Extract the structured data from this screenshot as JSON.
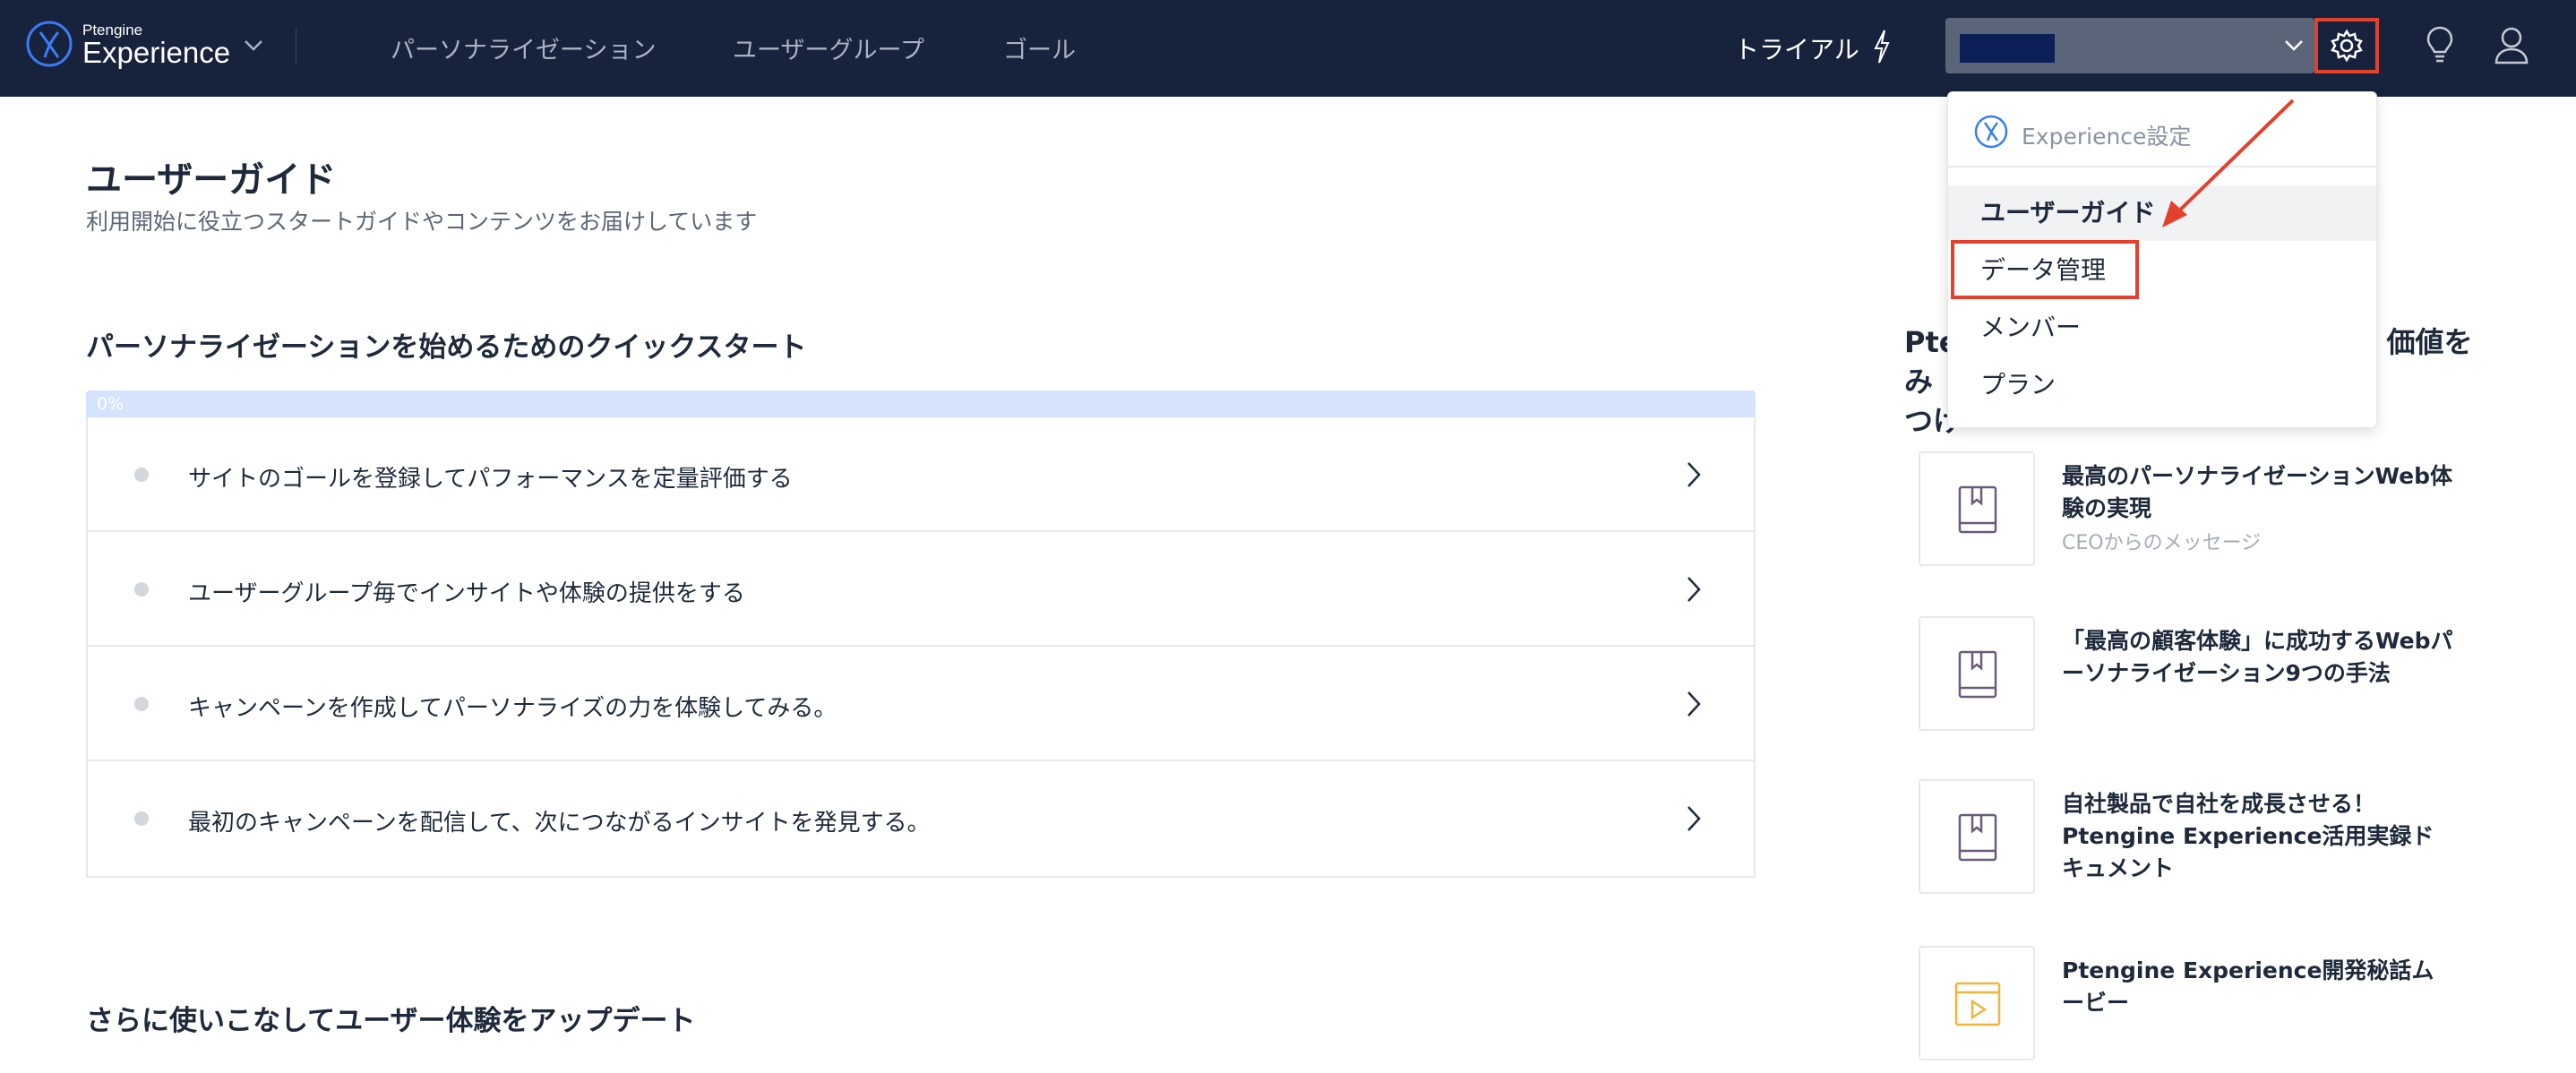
{
  "header": {
    "logo_small": "Ptengine",
    "logo_big": "Experience",
    "nav": [
      "パーソナライゼーション",
      "ユーザーグループ",
      "ゴール"
    ],
    "trial_label": "トライアル",
    "account_select_value": ""
  },
  "page": {
    "title": "ユーザーガイド",
    "subtitle": "利用開始に役立つスタートガイドやコンテンツをお届けしています"
  },
  "quickstart": {
    "title": "パーソナライゼーションを始めるためのクイックスタート",
    "progress": 0,
    "progress_label": "0%",
    "tasks": [
      "サイトのゴールを登録してパフォーマンスを定量評価する",
      "ユーザーグループ毎でインサイトや体験の提供をする",
      "キャンペーンを作成してパーソナライズの力を体験してみる。",
      "最初のキャンペーンを配信して、次につながるインサイトを発見する。"
    ]
  },
  "update_section": {
    "title": "さらに使いこなしてユーザー体験をアップデート"
  },
  "right_column": {
    "heading_start": "Pte",
    "heading_end": "価値をみ",
    "heading_line2": "つけ",
    "resources": [
      {
        "title": "最高のパーソナライゼーションWeb体験の実現",
        "subtitle": "CEOからのメッセージ",
        "icon": "book-icon"
      },
      {
        "title": "「最高の顧客体験」に成功するWebパーソナライゼーション9つの手法",
        "subtitle": "",
        "icon": "book-icon"
      },
      {
        "title": "自社製品で自社を成長させる！Ptengine Experience活用実録ドキュメント",
        "subtitle": "",
        "icon": "book-icon"
      },
      {
        "title": "Ptengine Experience開発秘話ムービー",
        "subtitle": "",
        "icon": "video-icon"
      }
    ]
  },
  "settings_menu": {
    "header_label": "Experience設定",
    "items": [
      "ユーザーガイド",
      "データ管理",
      "メンバー",
      "プラン"
    ],
    "active_item": "ユーザーガイド",
    "highlighted_item": "データ管理"
  },
  "colors": {
    "topbar": "#17233d",
    "accent_blue": "#2f6df6",
    "progress_track": "#d5e3fc",
    "highlight_red": "#e2412d",
    "resource_icon_purple": "#6b5b7b",
    "video_icon_yellow": "#f0b53b"
  }
}
